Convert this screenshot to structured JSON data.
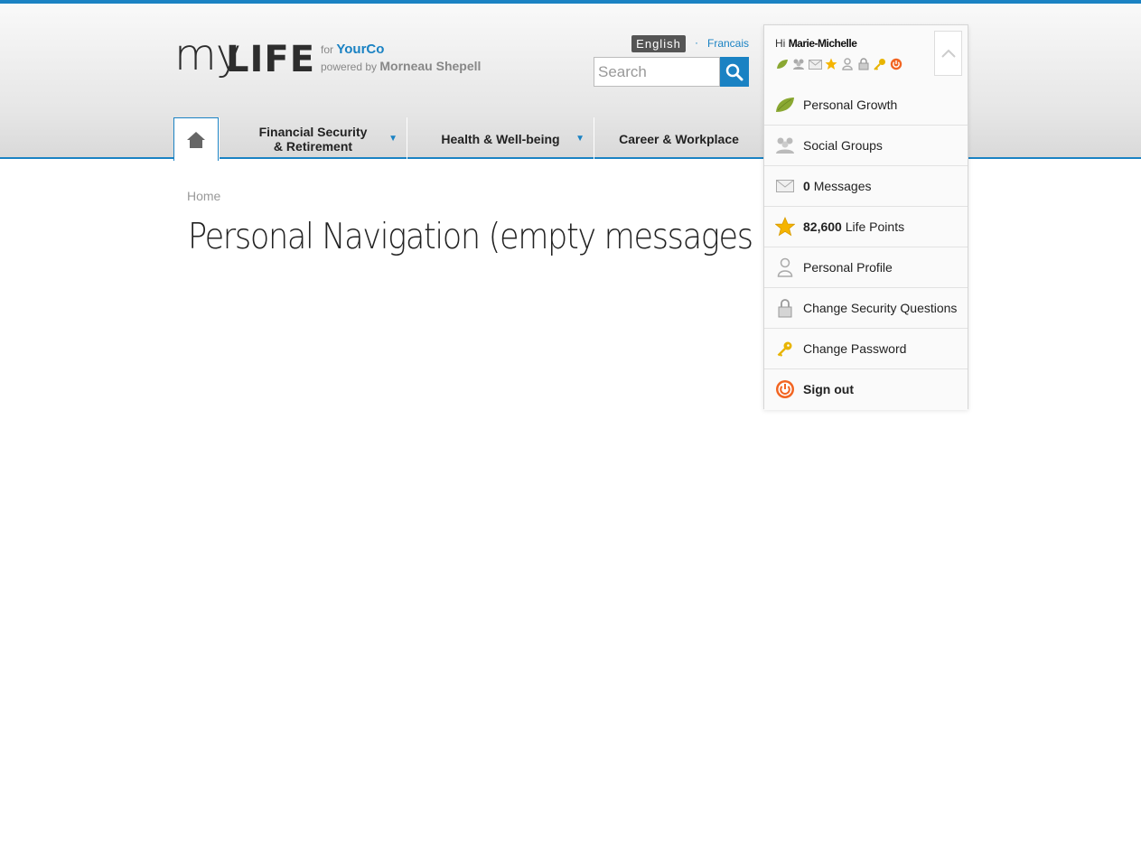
{
  "brand": {
    "logo_my": "my",
    "logo_life": "LIFE",
    "for_text": "for",
    "company": "YourCo",
    "powered_text": "powered by",
    "powered_company": "Morneau Shepell"
  },
  "language": {
    "current": "English",
    "separator": "·",
    "other": "Francais"
  },
  "search": {
    "placeholder": "Search"
  },
  "nav": {
    "home_icon": "house-icon",
    "tabs": [
      {
        "line1": "Financial Security",
        "line2": "& Retirement",
        "has_dropdown": true
      },
      {
        "label": "Health & Well-being",
        "has_dropdown": true
      },
      {
        "label": "Career & Workplace",
        "has_dropdown": false
      }
    ]
  },
  "breadcrumb": "Home",
  "page_title": "Personal Navigation (empty messages state)",
  "personal_panel": {
    "greeting": "Hi",
    "user_name": "Marie-Michelle",
    "mini_icons": [
      "leaf-icon",
      "people-icon",
      "envelope-icon",
      "star-icon",
      "person-icon",
      "lock-icon",
      "key-icon",
      "power-icon"
    ],
    "items": [
      {
        "icon": "leaf-icon",
        "label": "Personal Growth"
      },
      {
        "icon": "people-icon",
        "label": "Social Groups"
      },
      {
        "icon": "envelope-icon",
        "value": "0",
        "label": "Messages"
      },
      {
        "icon": "star-icon",
        "value": "82,600",
        "label": "Life Points"
      },
      {
        "icon": "person-icon",
        "label": "Personal Profile"
      },
      {
        "icon": "lock-icon",
        "label": "Change Security Questions"
      },
      {
        "icon": "key-icon",
        "label": "Change Password"
      },
      {
        "icon": "power-icon",
        "label": "Sign out"
      }
    ]
  },
  "colors": {
    "accent": "#1a82c3",
    "signout": "#f26522",
    "star": "#f5b400",
    "leaf": "#8aa832"
  }
}
